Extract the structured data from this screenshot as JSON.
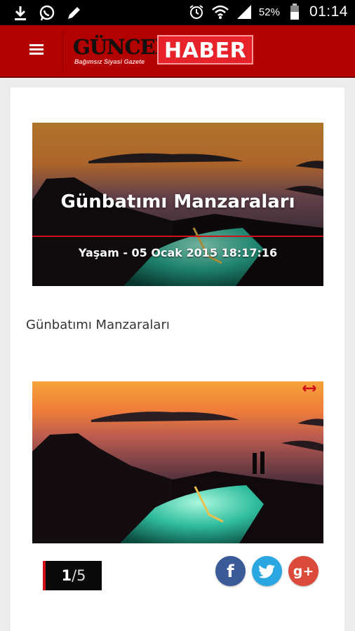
{
  "status_bar": {
    "battery_percent": "52%",
    "time": "01:14",
    "icons": [
      "download-icon",
      "whatsapp-icon",
      "pencil-icon",
      "alarm-icon",
      "wifi-icon",
      "signal-icon",
      "battery-icon"
    ]
  },
  "header": {
    "menu_icon": "hamburger-menu-icon",
    "logo_part1": "GÜNCEL",
    "logo_part2": "HABER",
    "logo_tagline": "Bağımsız Siyasi Gazete",
    "brand_color": "#b30000"
  },
  "article": {
    "title": "Günbatımı Manzaraları",
    "meta": "Yaşam - 05 Ocak 2015 18:17:16",
    "summary": "Günbatımı Manzaraları"
  },
  "gallery": {
    "current": "1",
    "separator": "/",
    "total": "5",
    "fullscreen_icon": "expand-arrows-icon"
  },
  "share": {
    "facebook_label": "f",
    "google_label": "g+",
    "colors": {
      "facebook": "#3b5b98",
      "twitter": "#2aa7e0",
      "google": "#db4a3a"
    }
  }
}
